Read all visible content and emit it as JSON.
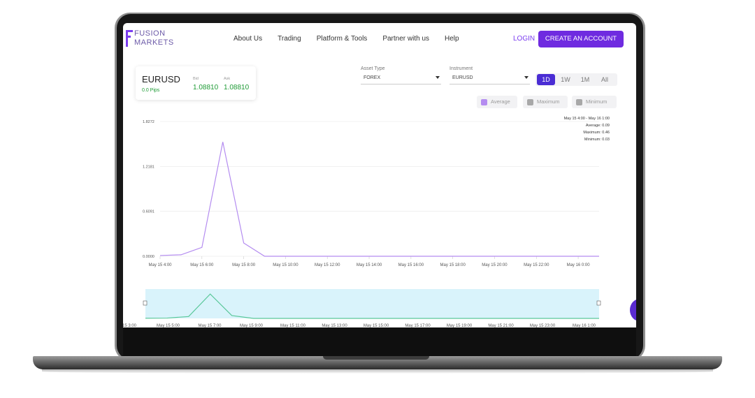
{
  "brand": {
    "line1": "FUSION",
    "line2": "MARKETS"
  },
  "nav": {
    "items": [
      "About Us",
      "Trading",
      "Platform & Tools",
      "Partner with us",
      "Help"
    ],
    "login": "LOGIN",
    "create": "CREATE AN ACCOUNT"
  },
  "quote": {
    "symbol": "EURUSD",
    "spread": "0.0 Pips",
    "bid_label": "Bid",
    "ask_label": "Ask",
    "bid": "1.08810",
    "ask": "1.08810"
  },
  "filters": {
    "asset_label": "Asset Type",
    "asset_value": "FOREX",
    "instrument_label": "Instrument",
    "instrument_value": "EURUSD"
  },
  "ranges": [
    "1D",
    "1W",
    "1M",
    "All"
  ],
  "active_range": "1D",
  "legend": [
    "Average",
    "Maximum",
    "Minimum"
  ],
  "tooltip": {
    "range": "May 15 4:00 - May 16 1:00",
    "average": "Average: 0.09",
    "maximum": "Maximum: 0.46",
    "minimum": "Minimum: 0.03"
  },
  "colors": {
    "accent": "#6f2be0",
    "average": "#b48cf0",
    "inactive": "#a8a8a8",
    "nav_line": "#5ac89a",
    "nav_fill": "#d9f3fb"
  },
  "chart_data": [
    {
      "type": "line",
      "title": "",
      "xlabel": "",
      "ylabel": "",
      "y_ticks": [
        "1.8272",
        "1.2181",
        "0.6091",
        "0.0000"
      ],
      "ylim": [
        0,
        1.8272
      ],
      "x_ticks": [
        "May 15 4:00",
        "May 15 6:00",
        "May 15 8:00",
        "May 15 10:00",
        "May 15 12:00",
        "May 15 14:00",
        "May 15 16:00",
        "May 15 18:00",
        "May 15 20:00",
        "May 15 22:00",
        "May 16 0:00"
      ],
      "x_hours": [
        4,
        5,
        6,
        7,
        8,
        9,
        10,
        11,
        12,
        13,
        14,
        15,
        16,
        17,
        18,
        19,
        20,
        21,
        22,
        23,
        24,
        25
      ],
      "series": [
        {
          "name": "Average",
          "values": [
            0.01,
            0.02,
            0.12,
            1.55,
            0.18,
            0,
            0,
            0,
            0,
            0,
            0,
            0,
            0,
            0,
            0,
            0,
            0,
            0,
            0,
            0,
            0,
            0
          ]
        }
      ],
      "grid": true
    },
    {
      "type": "area",
      "title": "",
      "x_ticks": [
        "ay 15 3:00",
        "May 15 5:00",
        "May 15 7:00",
        "May 15 9:00",
        "May 15 11:00",
        "May 15 13:00",
        "May 15 15:00",
        "May 15 17:00",
        "May 15 19:00",
        "May 15 21:00",
        "May 15 23:00",
        "May 16 1:00"
      ],
      "x_hours": [
        4,
        5,
        6,
        7,
        8,
        9,
        10,
        11,
        12,
        13,
        14,
        15,
        16,
        17,
        18,
        19,
        20,
        21,
        22,
        23,
        24,
        25
      ],
      "series": [
        {
          "name": "",
          "values": [
            0.01,
            0.02,
            0.12,
            1.55,
            0.18,
            0,
            0,
            0,
            0,
            0,
            0,
            0,
            0,
            0,
            0,
            0,
            0,
            0,
            0,
            0,
            0,
            0
          ]
        }
      ]
    }
  ]
}
